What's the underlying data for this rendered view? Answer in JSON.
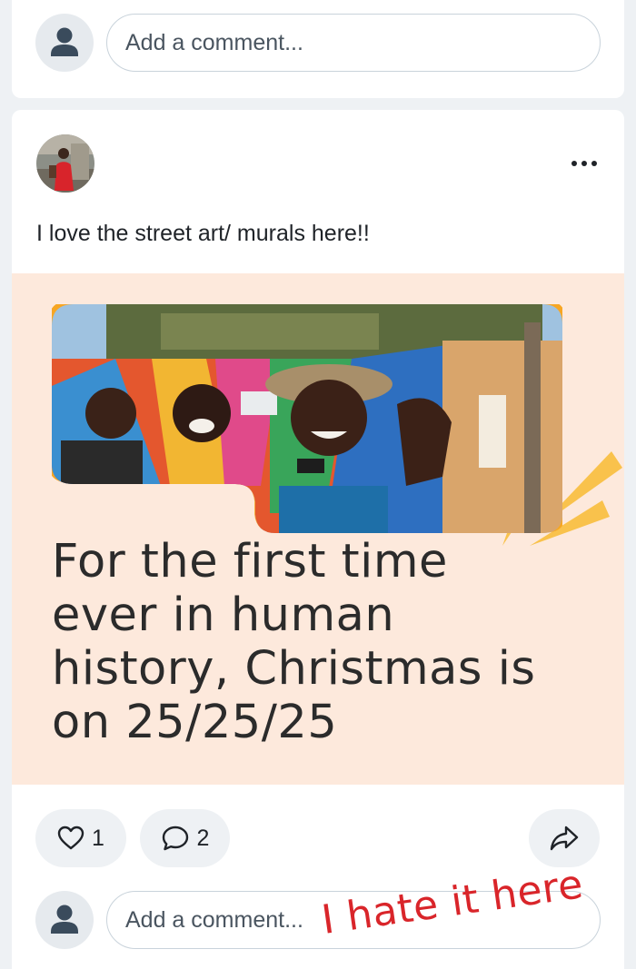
{
  "top_comment": {
    "placeholder": "Add a comment..."
  },
  "post": {
    "text": "I love the street art/ murals here!!",
    "menu_label": "•••",
    "image": {
      "headline_lines": [
        "For the first time",
        "ever in human",
        "history, Christmas is",
        "on 25/25/25"
      ],
      "background_color": "#fde9dc",
      "accent_color": "#f7a623"
    },
    "actions": {
      "like_count": "1",
      "comment_count": "2"
    },
    "comment": {
      "placeholder": "Add a comment..."
    }
  },
  "overlay": {
    "handwritten_text": "I hate it here",
    "color": "#d9252a"
  },
  "icons": {
    "user": "user-silhouette-icon",
    "like": "heart-icon",
    "comment": "speech-bubble-icon",
    "share": "share-arrow-icon",
    "more": "more-dots-icon"
  }
}
